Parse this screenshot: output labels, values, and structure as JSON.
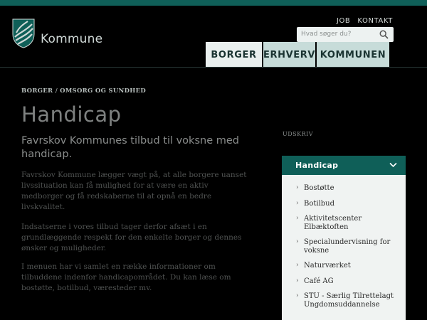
{
  "header": {
    "logo_text": "Kommune",
    "utility_links": [
      "JOB",
      "KONTAKT"
    ],
    "search_placeholder": "Hvad søger du?",
    "nav_tabs": [
      {
        "label": "BORGER",
        "active": true
      },
      {
        "label": "ERHVERV",
        "active": false
      },
      {
        "label": "KOMMUNEN",
        "active": false
      }
    ]
  },
  "breadcrumb": {
    "items": [
      "BORGER",
      "OMSORG OG SUNDHED"
    ],
    "separator": "/"
  },
  "main": {
    "title": "Handicap",
    "lead": "Favrskov Kommunes tilbud til voksne med handicap.",
    "paragraphs": [
      "Favrskov Kommune lægger vægt på, at alle borgere uanset livssituation kan få mulighed for at være en aktiv medborger og få redskaberne til at opnå en bedre livskvalitet.",
      "Indsatserne i vores tilbud tager derfor afsæt i en grundlæggende respekt for den enkelte borger og dennes ønsker og muligheder.",
      "I menuen har vi samlet en række informationer om tilbuddene indenfor handicapområdet. Du kan læse om bostøtte, botilbud, væresteder mv."
    ]
  },
  "sidebar": {
    "print_label": "UDSKRIV",
    "menu_title": "Handicap",
    "items": [
      "Bostøtte",
      "Botilbud",
      "Aktivitetscenter Elbæktoften",
      "Specialundervisning for voksne",
      "Naturværket",
      "Café AG",
      "STU - Særlig Tilrettelagt Ungdomsuddannelse"
    ]
  },
  "colors": {
    "accent": "#0f5f58",
    "nav_tab": "#c7dcd9",
    "nav_tab_active": "#eaf0ef",
    "background": "#000000",
    "sidebar_bg": "#f0f3f2"
  }
}
